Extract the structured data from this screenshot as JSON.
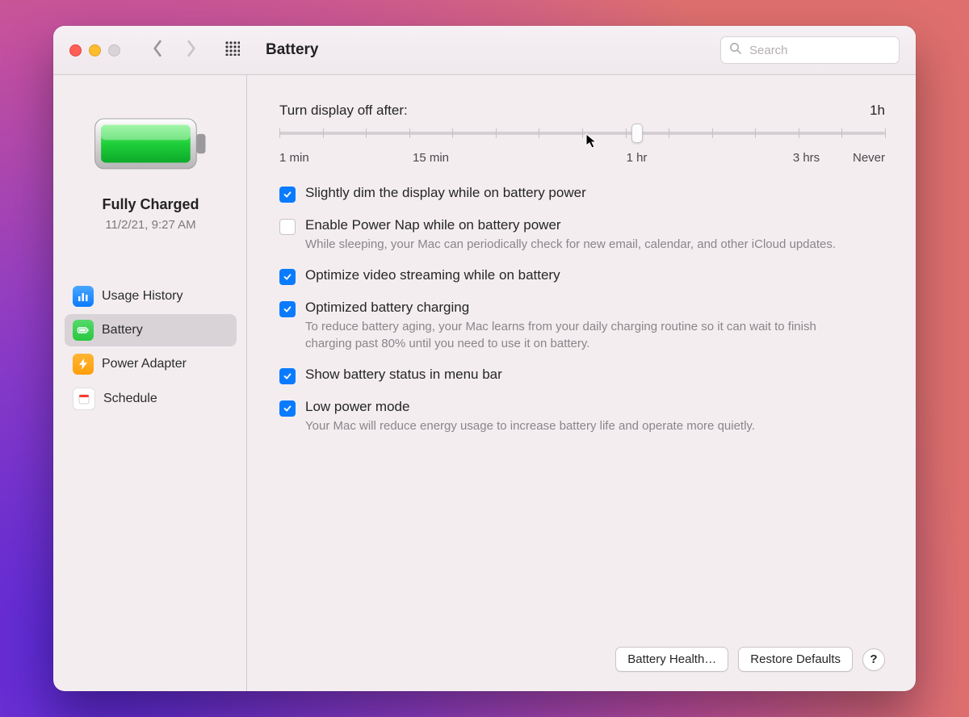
{
  "header": {
    "title": "Battery",
    "search_placeholder": "Search"
  },
  "sidebar": {
    "status_label": "Fully Charged",
    "status_time": "11/2/21, 9:27 AM",
    "items": [
      {
        "label": "Usage History",
        "icon": "chart-icon",
        "color": "blue",
        "selected": false
      },
      {
        "label": "Battery",
        "icon": "battery-icon",
        "color": "green",
        "selected": true
      },
      {
        "label": "Power Adapter",
        "icon": "bolt-icon",
        "color": "orange",
        "selected": false
      },
      {
        "label": "Schedule",
        "icon": "calendar-icon",
        "color": "white",
        "selected": false
      }
    ]
  },
  "main": {
    "slider": {
      "label": "Turn display off after:",
      "value_label": "1h",
      "value_percent": 59,
      "tick_labels": [
        {
          "text": "1 min",
          "percent": 0
        },
        {
          "text": "15 min",
          "percent": 25
        },
        {
          "text": "1 hr",
          "percent": 59
        },
        {
          "text": "3 hrs",
          "percent": 87
        },
        {
          "text": "Never",
          "percent": 100
        }
      ]
    },
    "options": [
      {
        "checked": true,
        "label": "Slightly dim the display while on battery power",
        "desc": ""
      },
      {
        "checked": false,
        "label": "Enable Power Nap while on battery power",
        "desc": "While sleeping, your Mac can periodically check for new email, calendar, and other iCloud updates."
      },
      {
        "checked": true,
        "label": "Optimize video streaming while on battery",
        "desc": ""
      },
      {
        "checked": true,
        "label": "Optimized battery charging",
        "desc": "To reduce battery aging, your Mac learns from your daily charging routine so it can wait to finish charging past 80% until you need to use it on battery."
      },
      {
        "checked": true,
        "label": "Show battery status in menu bar",
        "desc": ""
      },
      {
        "checked": true,
        "label": "Low power mode",
        "desc": "Your Mac will reduce energy usage to increase battery life and operate more quietly."
      }
    ],
    "footer": {
      "battery_health": "Battery Health…",
      "restore_defaults": "Restore Defaults",
      "help": "?"
    }
  }
}
